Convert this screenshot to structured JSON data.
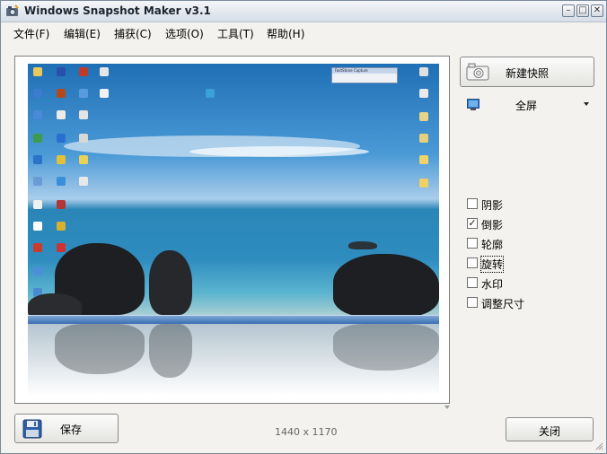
{
  "window": {
    "title": "Windows Snapshot Maker v3.1",
    "controls": {
      "minimize": "–",
      "maximize": "□",
      "close": "✕"
    }
  },
  "menu": [
    {
      "label": "文件(F)"
    },
    {
      "label": "编辑(E)"
    },
    {
      "label": "捕获(C)"
    },
    {
      "label": "选项(O)"
    },
    {
      "label": "工具(T)"
    },
    {
      "label": "帮助(H)"
    }
  ],
  "preview": {
    "inner_window_title": "FastStone Capture"
  },
  "capture": {
    "new_snapshot_label": "新建快照",
    "mode_value": "全屏"
  },
  "effects": [
    {
      "label": "阴影",
      "checked": false
    },
    {
      "label": "倒影",
      "checked": true
    },
    {
      "label": "轮廓",
      "checked": false
    },
    {
      "label": "旋转",
      "checked": false
    },
    {
      "label": "水印",
      "checked": false
    },
    {
      "label": "调整尺寸",
      "checked": false
    }
  ],
  "footer": {
    "save_label": "保存",
    "dimensions": "1440 x 1170",
    "close_label": "关闭"
  },
  "icons": {
    "app": "camera-app-icon",
    "camera": "camera-icon",
    "monitor": "monitor-icon",
    "save": "floppy-disk-icon",
    "dropdown": "triangle-down-icon"
  }
}
